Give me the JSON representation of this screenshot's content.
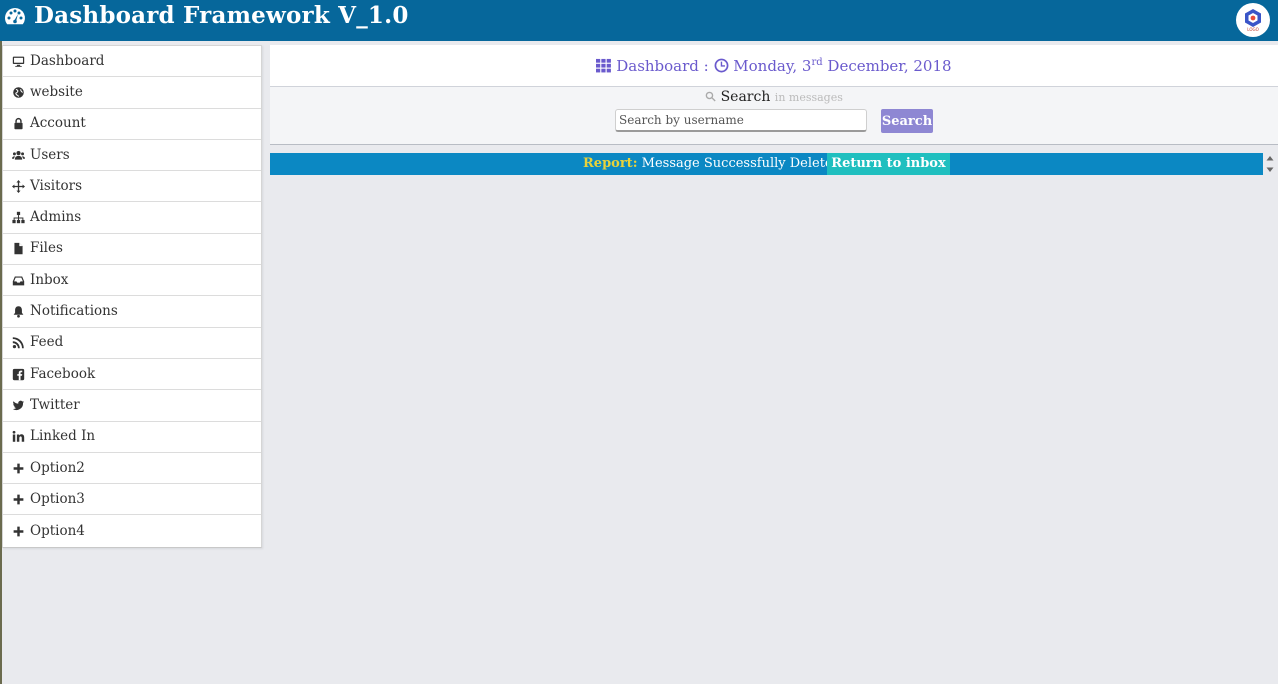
{
  "header": {
    "title": "Dashboard Framework V_1.0",
    "avatar_text": "LOGO"
  },
  "sidebar": {
    "items": [
      {
        "label": "Dashboard",
        "icon": "desktop-icon"
      },
      {
        "label": "website",
        "icon": "globe-icon"
      },
      {
        "label": "Account",
        "icon": "lock-icon"
      },
      {
        "label": "Users",
        "icon": "users-icon"
      },
      {
        "label": "Visitors",
        "icon": "arrows-icon"
      },
      {
        "label": "Admins",
        "icon": "sitemap-icon"
      },
      {
        "label": "Files",
        "icon": "file-icon"
      },
      {
        "label": "Inbox",
        "icon": "inbox-icon"
      },
      {
        "label": "Notifications",
        "icon": "bell-icon"
      },
      {
        "label": "Feed",
        "icon": "rss-icon"
      },
      {
        "label": "Facebook",
        "icon": "facebook-icon"
      },
      {
        "label": "Twitter",
        "icon": "twitter-icon"
      },
      {
        "label": "Linked In",
        "icon": "linkedin-icon"
      },
      {
        "label": "Option2",
        "icon": "plus-icon"
      },
      {
        "label": "Option3",
        "icon": "plus-icon"
      },
      {
        "label": "Option4",
        "icon": "plus-icon"
      }
    ]
  },
  "main": {
    "breadcrumb": "Dashboard :",
    "date_prefix": "Monday, 3",
    "date_sup": "rd",
    "date_suffix": "December, 2018",
    "search": {
      "caption": "Search",
      "hint": "in messages",
      "placeholder": "Search by username",
      "button_label": "Search"
    },
    "report": {
      "label": "Report:",
      "message": "Message Successfully Deleted.",
      "return_label": "Return to inbox"
    }
  },
  "colors": {
    "header_bg": "#06679b",
    "accent": "#6a5acd",
    "report_bg": "#0b88c3",
    "return_bg": "#1fbfbf",
    "report_label": "#e8d23b"
  }
}
